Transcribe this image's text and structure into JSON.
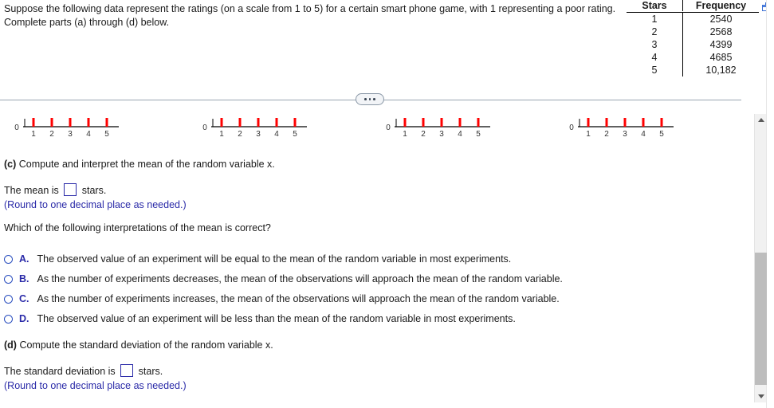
{
  "question": {
    "text": "Suppose the following data represent the ratings (on a scale from 1 to 5) for a certain smart phone game, with 1 representing a poor rating. Complete parts (a) through (d) below."
  },
  "frequency_table": {
    "headers": [
      "Stars",
      "Frequency"
    ],
    "rows": [
      {
        "stars": "1",
        "frequency": "2540"
      },
      {
        "stars": "2",
        "frequency": "2568"
      },
      {
        "stars": "3",
        "frequency": "4399"
      },
      {
        "stars": "4",
        "frequency": "4685"
      },
      {
        "stars": "5",
        "frequency": "10,182"
      }
    ],
    "popout_icon": "popout-window-icon"
  },
  "divider": {
    "label": "collapsed-section-ellipsis"
  },
  "graph_choices": {
    "axis_origin_label": "0",
    "tick_labels": [
      "1",
      "2",
      "3",
      "4",
      "5"
    ],
    "bar_color": "#ff0000",
    "plots": [
      {
        "name": "graph-choice-a",
        "values": [
          1,
          1,
          1,
          1,
          1
        ]
      },
      {
        "name": "graph-choice-b",
        "values": [
          1,
          1,
          1,
          1,
          1
        ]
      },
      {
        "name": "graph-choice-c",
        "values": [
          1,
          1,
          1,
          1,
          1
        ]
      },
      {
        "name": "graph-choice-d",
        "values": [
          1,
          1,
          1,
          1,
          1
        ]
      }
    ]
  },
  "part_c": {
    "label": "(c)",
    "prompt": "Compute and interpret the mean of the random variable x.",
    "mean_prefix": "The mean is",
    "mean_value": "",
    "mean_suffix": "stars.",
    "rounding_note": "(Round to one decimal place as needed.)",
    "mc_question": "Which of the following interpretations of the mean is correct?",
    "choices": [
      {
        "letter": "A.",
        "text": "The observed value of an experiment will be equal to the mean of the random variable in most experiments.",
        "selected": false
      },
      {
        "letter": "B.",
        "text": "As the number of experiments decreases, the mean of the observations will approach the mean of the random variable.",
        "selected": false
      },
      {
        "letter": "C.",
        "text": "As the number of experiments increases, the mean of the observations will approach the mean of the random variable.",
        "selected": false
      },
      {
        "letter": "D.",
        "text": "The observed value of an experiment will be less than the mean of the random variable in most experiments.",
        "selected": false
      }
    ]
  },
  "part_d": {
    "label": "(d)",
    "prompt": "Compute the standard deviation of the random variable x.",
    "sd_prefix": "The standard deviation is",
    "sd_value": "",
    "sd_suffix": "stars.",
    "rounding_note": "(Round to one decimal place as needed.)"
  },
  "scrollbar": {
    "up_arrow": "scroll-up-arrow",
    "down_arrow": "scroll-down-arrow",
    "thumb_top_pct": 48,
    "thumb_height_pct": 46
  },
  "colors": {
    "blue_text": "#2a2aa8",
    "bar_red": "#ff0000",
    "divider": "#9aa5b1"
  }
}
